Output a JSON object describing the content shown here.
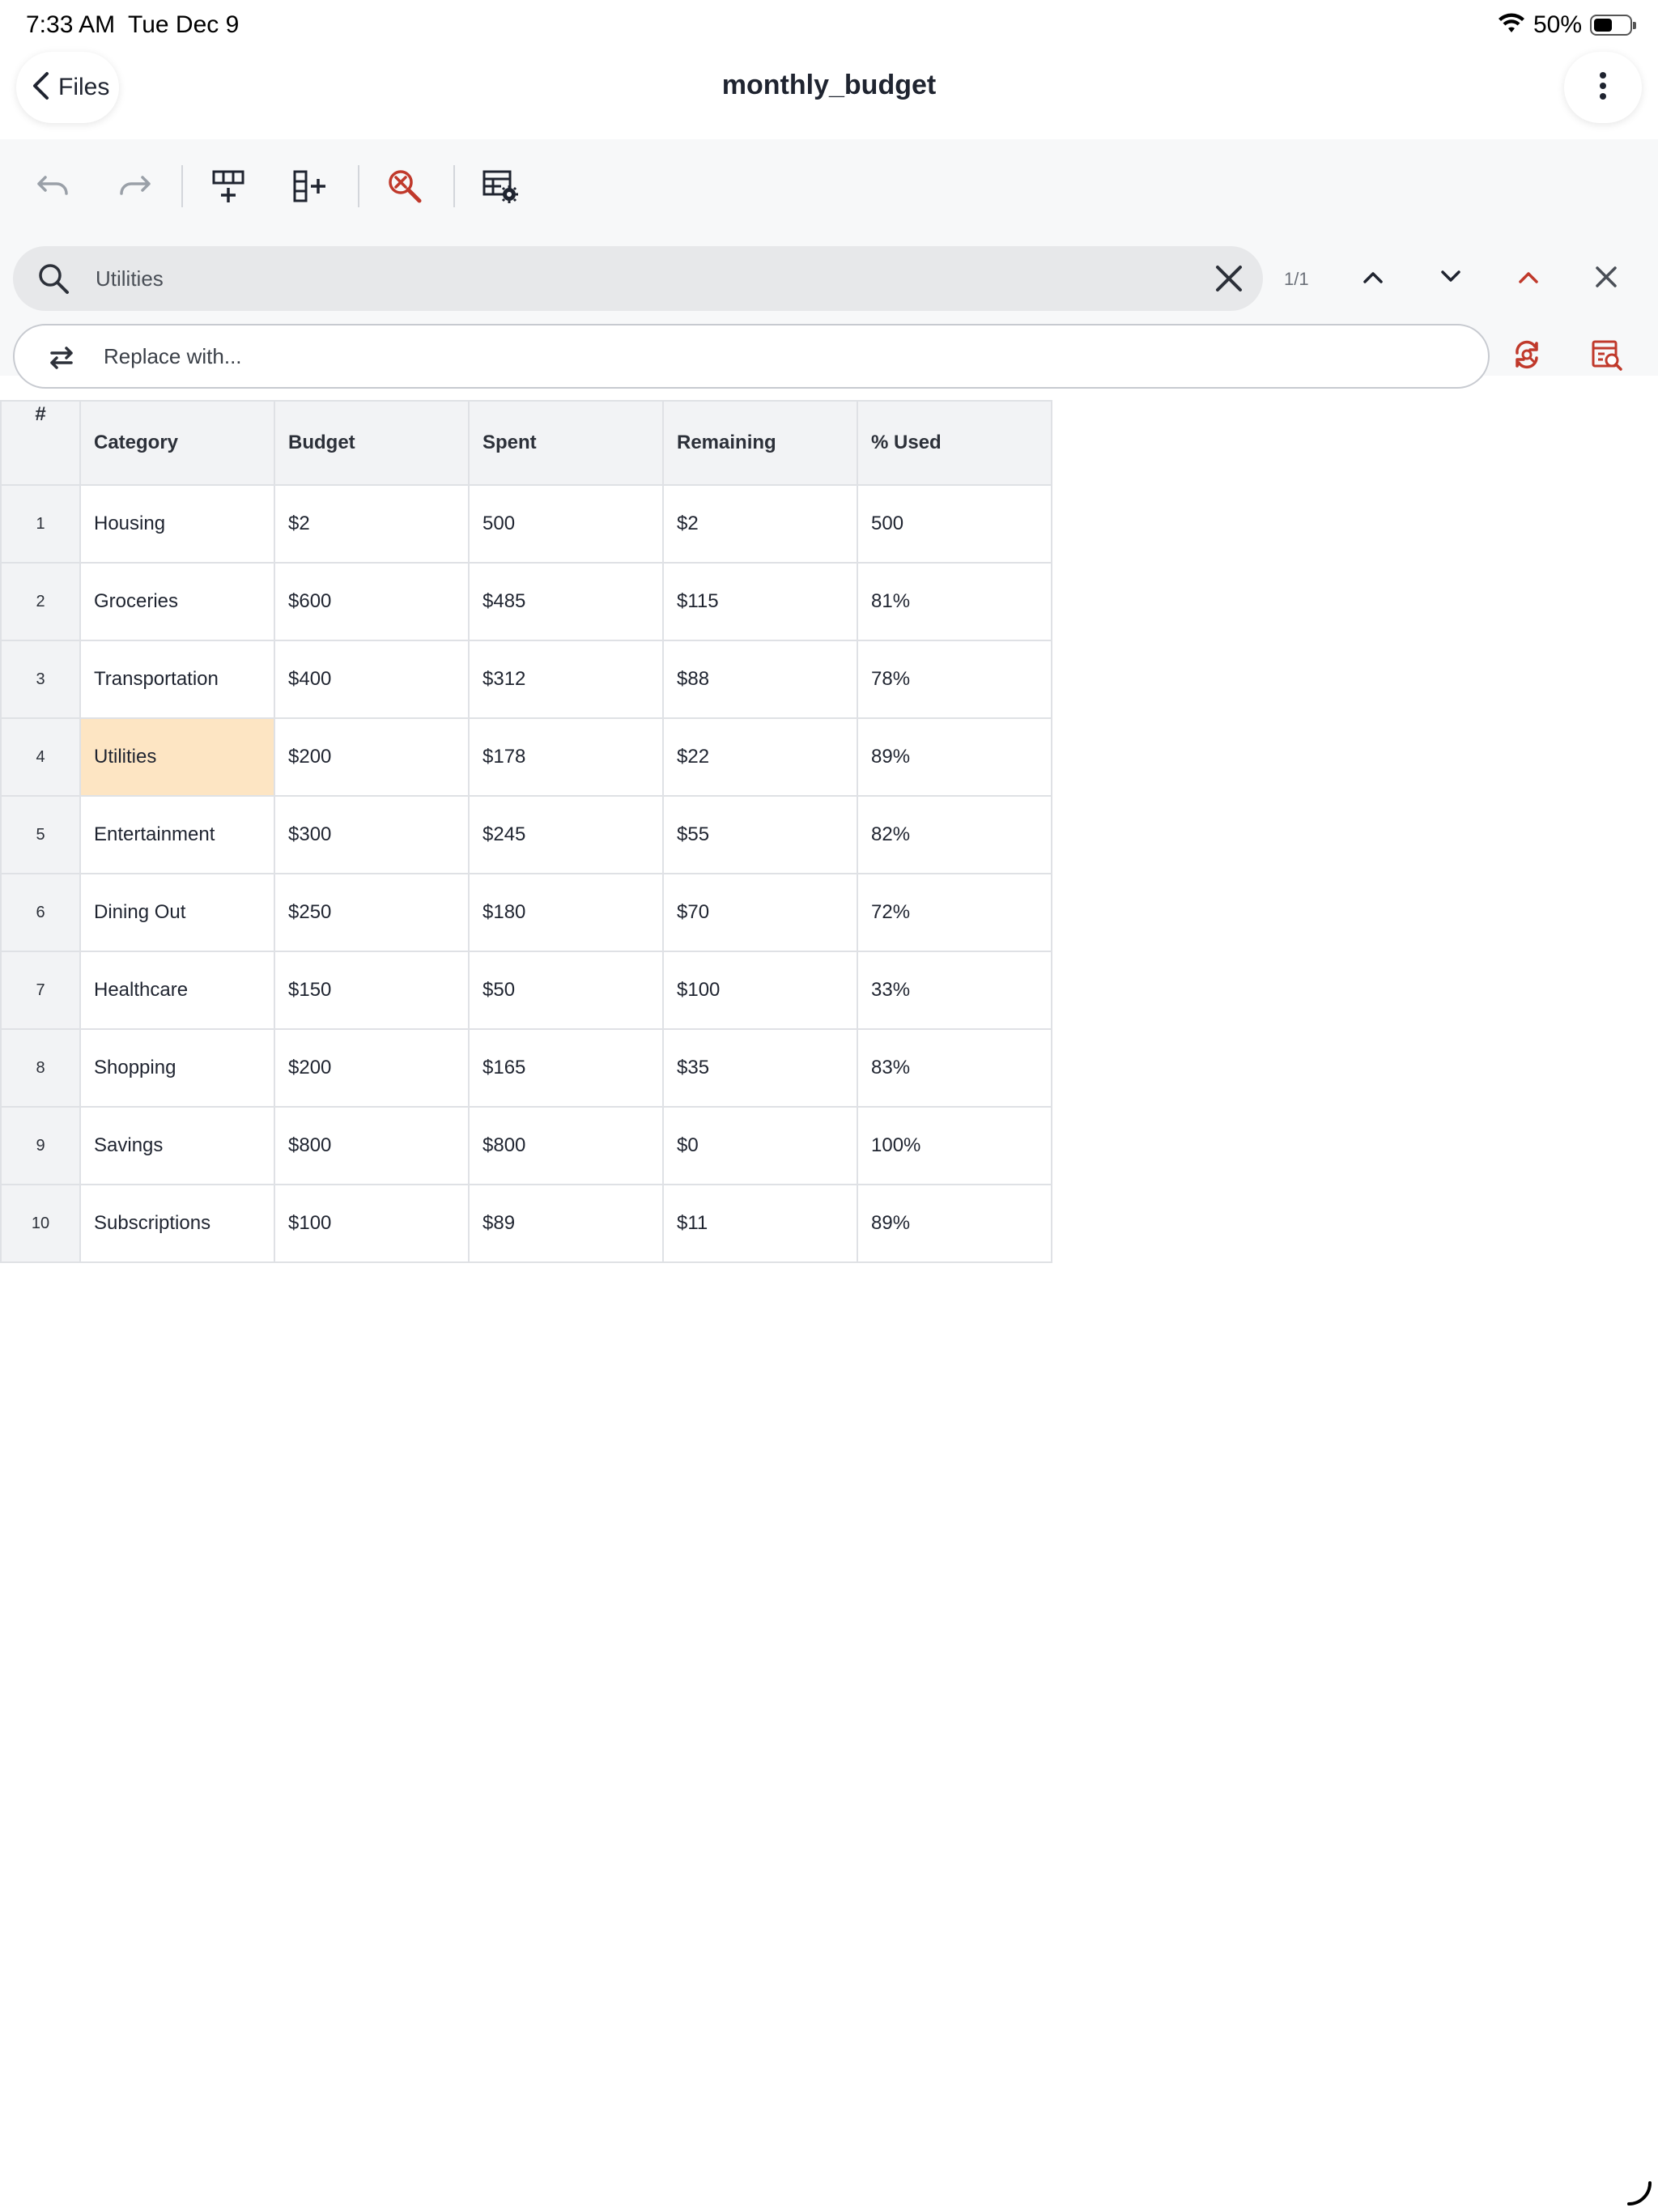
{
  "status_bar": {
    "time": "7:33 AM",
    "date": "Tue Dec 9",
    "battery": "50%"
  },
  "nav": {
    "back_label": "Files",
    "title": "monthly_budget"
  },
  "toolbar": {
    "icons": [
      "undo-icon",
      "redo-icon",
      "insert-row-icon",
      "insert-column-icon",
      "clear-search-icon",
      "table-settings-icon"
    ]
  },
  "find": {
    "query": "Utilities",
    "match_count": "1/1"
  },
  "replace": {
    "placeholder": "Replace with..."
  },
  "colors": {
    "accent": "#c0392b",
    "highlight": "#fde5c3",
    "header_bg": "#f2f3f5"
  },
  "grid": {
    "corner": "#",
    "headers": [
      "Category",
      "Budget",
      "Spent",
      "Remaining",
      "% Used"
    ],
    "rows": [
      {
        "num": "1",
        "cells": [
          "Housing",
          "$2",
          "500",
          "$2",
          "500"
        ]
      },
      {
        "num": "2",
        "cells": [
          "Groceries",
          "$600",
          "$485",
          "$115",
          "81%"
        ]
      },
      {
        "num": "3",
        "cells": [
          "Transportation",
          "$400",
          "$312",
          "$88",
          "78%"
        ]
      },
      {
        "num": "4",
        "cells": [
          "Utilities",
          "$200",
          "$178",
          "$22",
          "89%"
        ]
      },
      {
        "num": "5",
        "cells": [
          "Entertainment",
          "$300",
          "$245",
          "$55",
          "82%"
        ]
      },
      {
        "num": "6",
        "cells": [
          "Dining Out",
          "$250",
          "$180",
          "$70",
          "72%"
        ]
      },
      {
        "num": "7",
        "cells": [
          "Healthcare",
          "$150",
          "$50",
          "$100",
          "33%"
        ]
      },
      {
        "num": "8",
        "cells": [
          "Shopping",
          "$200",
          "$165",
          "$35",
          "83%"
        ]
      },
      {
        "num": "9",
        "cells": [
          "Savings",
          "$800",
          "$800",
          "$0",
          "100%"
        ]
      },
      {
        "num": "10",
        "cells": [
          "Subscriptions",
          "$100",
          "$89",
          "$11",
          "89%"
        ]
      }
    ]
  }
}
